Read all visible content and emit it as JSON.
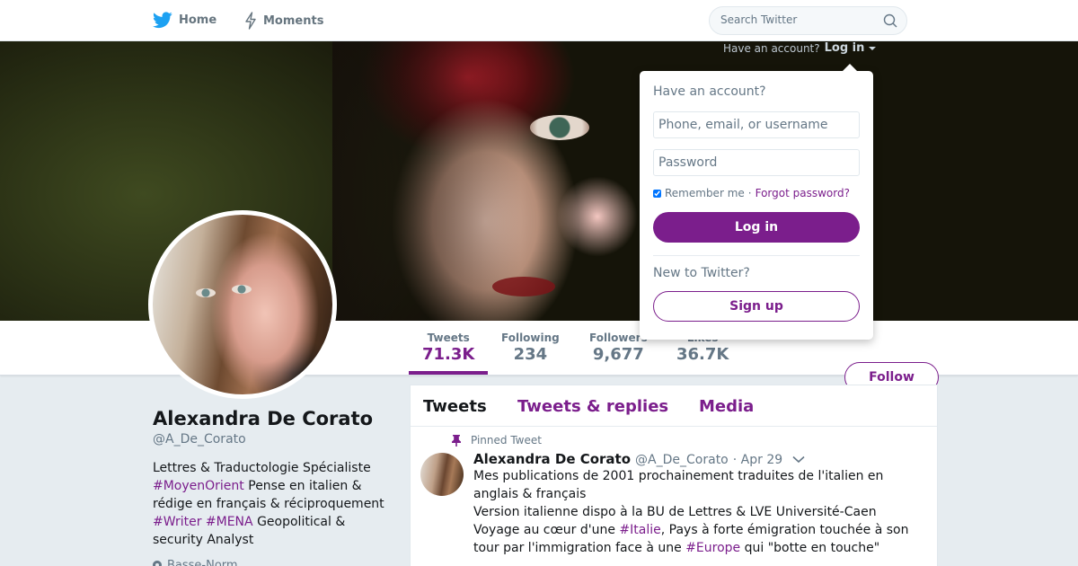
{
  "nav": {
    "home_label": "Home",
    "moments_label": "Moments",
    "search_placeholder": "Search Twitter"
  },
  "account_bar": {
    "question": "Have an account?",
    "login_label": "Log in"
  },
  "login_popup": {
    "heading": "Have an account?",
    "username_placeholder": "Phone, email, or username",
    "password_placeholder": "Password",
    "remember_label": "Remember me",
    "separator": "·",
    "forgot_label": "Forgot password?",
    "login_button": "Log in",
    "new_heading": "New to Twitter?",
    "signup_button": "Sign up"
  },
  "stats": [
    {
      "label": "Tweets",
      "value": "71.3K"
    },
    {
      "label": "Following",
      "value": "234"
    },
    {
      "label": "Followers",
      "value": "9,677"
    },
    {
      "label": "Likes",
      "value": "36.7K"
    }
  ],
  "follow_button": "Follow",
  "profile": {
    "name": "Alexandra De Corato",
    "handle": "@A_De_Corato",
    "bio": {
      "line1": "Lettres & Traductologie Spécialiste",
      "tag1": "#MoyenOrient",
      "text2": " Pense en italien &",
      "line3": "rédige en français & réciproquement",
      "tag2": "#Writer",
      "tag3": "#MENA",
      "text4": " Geopolitical &",
      "line5": "security Analyst"
    },
    "location": "Basse-Norm..."
  },
  "timeline": {
    "tabs": [
      "Tweets",
      "Tweets & replies",
      "Media"
    ],
    "pinned_label": "Pinned Tweet",
    "tweet": {
      "name": "Alexandra De Corato",
      "handle": "@A_De_Corato",
      "date": "· Apr 29",
      "line1": "Mes publications de 2001 prochainement traduites de l'italien en",
      "line2": "anglais & français",
      "line3": "Version italienne dispo à la BU de Lettres & LVE Université-Caen",
      "line4_a": "Voyage au cœur d'une ",
      "line4_tag": "#Italie",
      "line4_b": ", Pays à forte émigration touchée à son",
      "line5_a": "tour par l'immigration face à une ",
      "line5_tag": "#Europe",
      "line5_b": " qui \"botte en touche\""
    }
  },
  "colors": {
    "accent": "#7b1e8c",
    "twitter_blue": "#1da1f2",
    "muted": "#657786"
  }
}
